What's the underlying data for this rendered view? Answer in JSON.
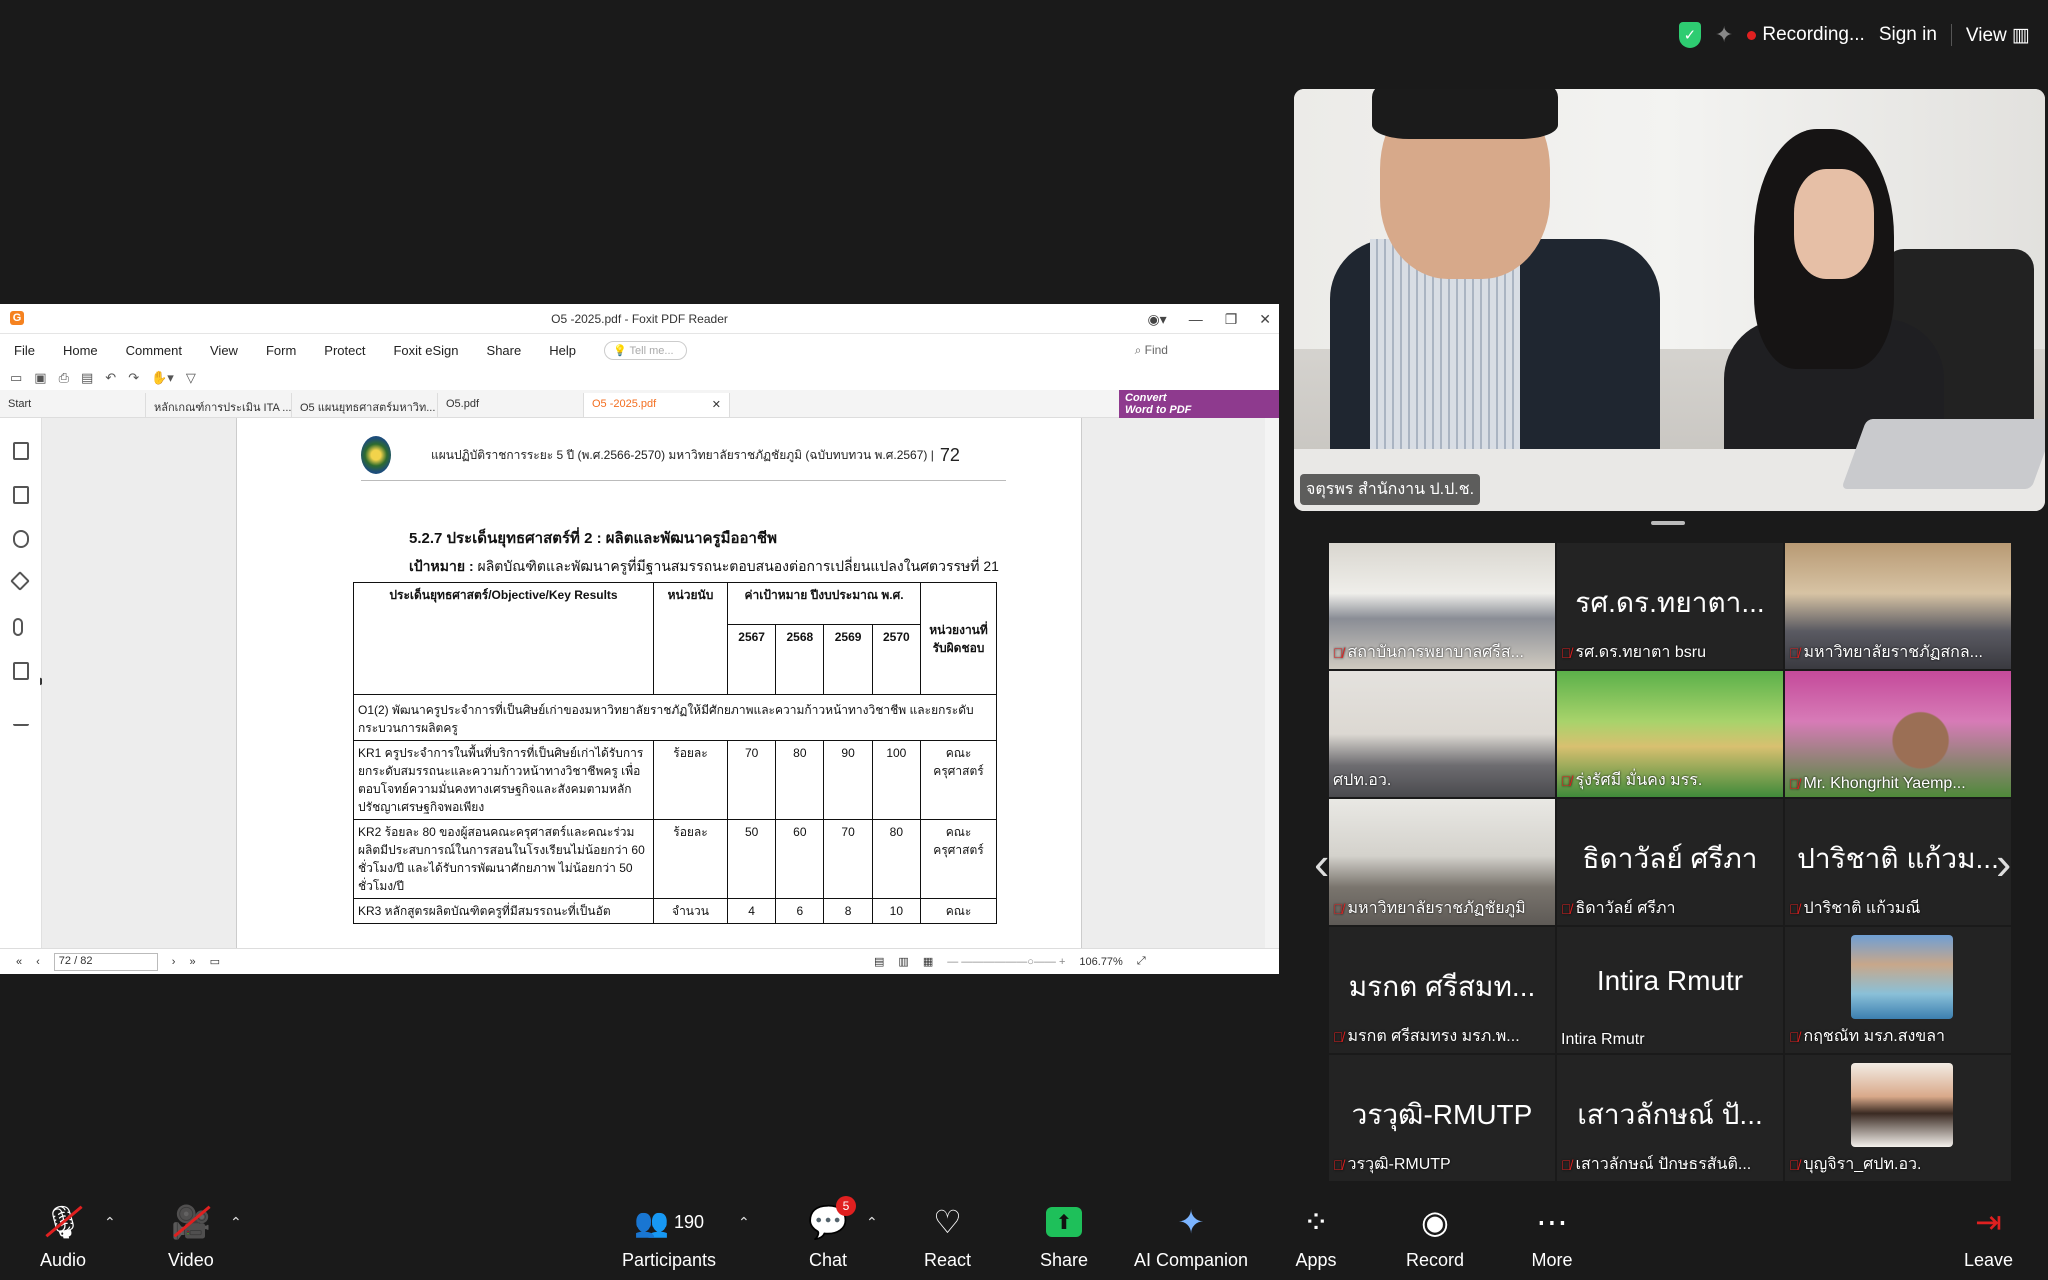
{
  "topbar": {
    "recording": "Recording...",
    "sign_in": "Sign in",
    "view": "View"
  },
  "pdf": {
    "title": "O5 -2025.pdf - Foxit PDF Reader",
    "menu": [
      "File",
      "Home",
      "Comment",
      "View",
      "Form",
      "Protect",
      "Foxit eSign",
      "Share",
      "Help"
    ],
    "tell_me": "Tell me...",
    "find_placeholder": "Find",
    "tabs": [
      "Start",
      "หลักเกณฑ์การประเมิน ITA ...",
      "O5 แผนยุทธศาสตร์มหาวิท...",
      "O5.pdf",
      "O5 -2025.pdf"
    ],
    "convert_line1": "Convert",
    "convert_line2": "Word to PDF",
    "page_field": "72 / 82",
    "zoom": "106.77%",
    "doc": {
      "header": "แผนปฏิบัติราชการระยะ 5 ปี (พ.ศ.2566-2570) มหาวิทยาลัยราชภัฏชัยภูมิ (ฉบับทบทวน พ.ศ.2567) |",
      "page_number": "72",
      "section_title": "5.2.7 ประเด็นยุทธศาสตร์ที่ 2 : ผลิตและพัฒนาครูมืออาชีพ",
      "goal_label": "เป้าหมาย :",
      "goal_text": "ผลิตบัณฑิตและพัฒนาครูที่มีฐานสมรรถนะตอบสนองต่อการเปลี่ยนแปลงในศตวรรษที่ 21",
      "table": {
        "h_strategy": "ประเด็นยุทธศาสตร์/Objective/Key Results",
        "h_unit": "หน่วยนับ",
        "h_target": "ค่าเป้าหมาย ปีงบประมาณ พ.ศ.",
        "h_resp": "หน่วยงานที่รับผิดชอบ",
        "years": [
          "2567",
          "2568",
          "2569",
          "2570"
        ],
        "objective": "O1(2) พัฒนาครูประจำการที่เป็นศิษย์เก่าของมหาวิทยาลัยราชภัฏให้มีศักยภาพและความก้าวหน้าทางวิชาชีพ และยกระดับกระบวนการผลิตครู",
        "rows": [
          {
            "text": "KR1 ครูประจำการในพื้นที่บริการที่เป็นศิษย์เก่าได้รับการยกระดับสมรรถนะและความก้าวหน้าทางวิชาชีพครู เพื่อตอบโจทย์ความมั่นคงทางเศรษฐกิจและสังคมตามหลักปรัชญาเศรษฐกิจพอเพียง",
            "unit": "ร้อยละ",
            "v": [
              "70",
              "80",
              "90",
              "100"
            ],
            "resp": "คณะครุศาสตร์"
          },
          {
            "text": "KR2 ร้อยละ 80 ของผู้สอนคณะครุศาสตร์และคณะร่วมผลิตมีประสบการณ์ในการสอนในโรงเรียนไม่น้อยกว่า 60 ชั่วโมง/ปี และได้รับการพัฒนาศักยภาพ ไม่น้อยกว่า 50 ชั่วโมง/ปี",
            "unit": "ร้อยละ",
            "v": [
              "50",
              "60",
              "70",
              "80"
            ],
            "resp": "คณะครุศาสตร์"
          },
          {
            "text": "KR3 หลักสูตรผลิตบัณฑิตครูที่มีสมรรถนะที่เป็นอัต",
            "unit": "จำนวน",
            "v": [
              "4",
              "6",
              "8",
              "10"
            ],
            "resp": "คณะ"
          }
        ]
      }
    }
  },
  "speaker": {
    "name": "จตุรพร สำนักงาน ป.ป.ช."
  },
  "gallery": [
    {
      "big": "",
      "name": "สถาบันการพยาบาลศรีส..."
    },
    {
      "big": "รศ.ดร.ทยาตา...",
      "name": "รศ.ดร.ทยาตา bsru"
    },
    {
      "big": "",
      "name": "มหาวิทยาลัยราชภัฏสกล..."
    },
    {
      "big": "",
      "name": "ศปท.อว."
    },
    {
      "big": "",
      "name": "รุ่งรัศมี มั่นคง มรร."
    },
    {
      "big": "",
      "name": "Mr. Khongrhit Yaemp..."
    },
    {
      "big": "",
      "name": "มหาวิทยาลัยราชภัฏชัยภูมิ"
    },
    {
      "big": "ธิดาวัลย์ ศรีภา",
      "name": "ธิดาวัลย์ ศรีภา"
    },
    {
      "big": "ปาริชาติ แก้วม...",
      "name": "ปาริชาติ แก้วมณี"
    },
    {
      "big": "มรกต ศรีสมท...",
      "name": "มรกต ศรีสมทรง มรภ.พ..."
    },
    {
      "big": "Intira Rmutr",
      "name": "Intira Rmutr"
    },
    {
      "big": "",
      "name": "กฤชณัท มรภ.สงขลา"
    },
    {
      "big": "วรวุฒิ-RMUTP",
      "name": "วรวุฒิ-RMUTP"
    },
    {
      "big": "เสาวลักษณ์ ปั...",
      "name": "เสาวลักษณ์ ปักษธรสันติ..."
    },
    {
      "big": "",
      "name": "บุญจิรา_ศปท.อว."
    }
  ],
  "controls": {
    "audio": "Audio",
    "video": "Video",
    "participants": "Participants",
    "participant_count": "190",
    "chat": "Chat",
    "chat_badge": "5",
    "react": "React",
    "share": "Share",
    "ai": "AI Companion",
    "apps": "Apps",
    "record": "Record",
    "more": "More",
    "leave": "Leave"
  }
}
